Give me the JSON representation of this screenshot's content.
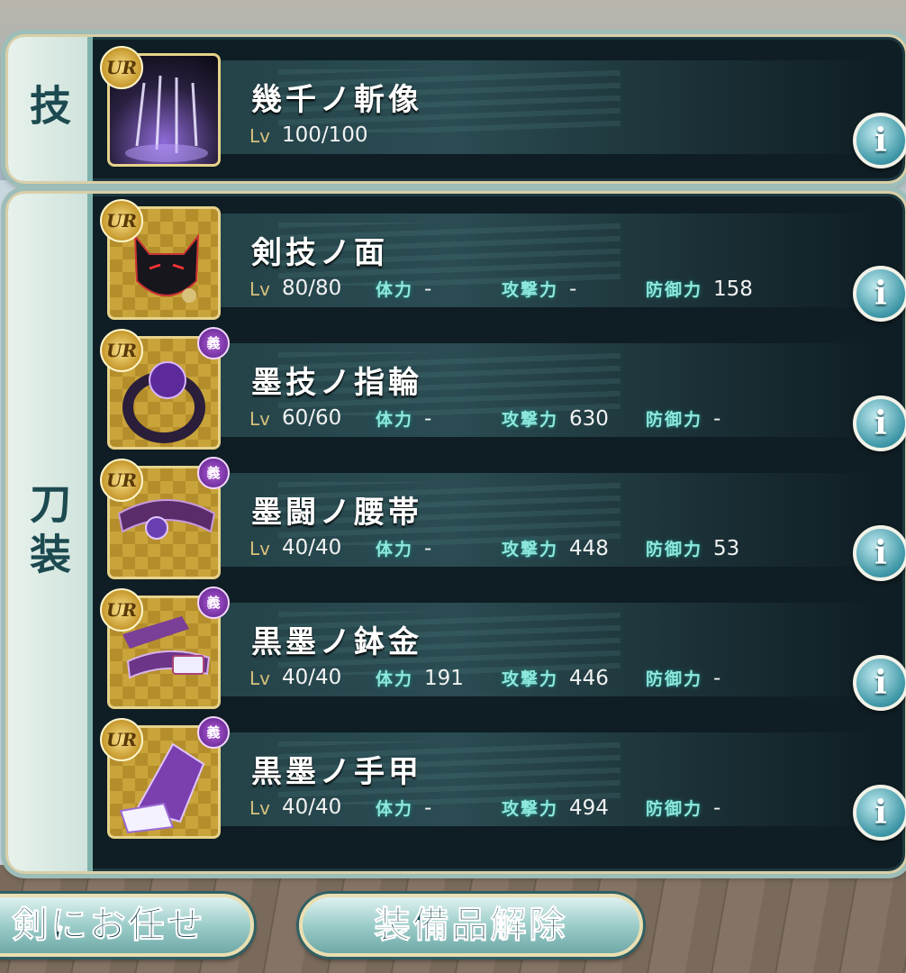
{
  "skill_section": {
    "label": "技",
    "item": {
      "rarity": "UR",
      "name": "幾千ノ斬像",
      "lv_key": "Lv",
      "lv": "100/100"
    }
  },
  "equip_section": {
    "label": "刀装",
    "stat_labels": {
      "hp": "体力",
      "atk": "攻撃力",
      "def": "防御力"
    },
    "items": [
      {
        "rarity": "UR",
        "mark": "",
        "name": "剣技ノ面",
        "lv": "80/80",
        "hp": "-",
        "atk": "-",
        "def": "158"
      },
      {
        "rarity": "UR",
        "mark": "義",
        "name": "墨技ノ指輪",
        "lv": "60/60",
        "hp": "-",
        "atk": "630",
        "def": "-"
      },
      {
        "rarity": "UR",
        "mark": "義",
        "name": "墨闘ノ腰帯",
        "lv": "40/40",
        "hp": "-",
        "atk": "448",
        "def": "53"
      },
      {
        "rarity": "UR",
        "mark": "義",
        "name": "黒墨ノ鉢金",
        "lv": "40/40",
        "hp": "191",
        "atk": "446",
        "def": "-"
      },
      {
        "rarity": "UR",
        "mark": "義",
        "name": "黒墨ノ手甲",
        "lv": "40/40",
        "hp": "-",
        "atk": "494",
        "def": "-"
      }
    ]
  },
  "info_icon": "i",
  "buttons": {
    "auto": "剣にお任せ",
    "release": "装備品解除"
  },
  "colors": {
    "panel": "#0f1e24",
    "frame": "#d9cfa7",
    "stat_label": "#8fe8dc",
    "lv_label": "#d6c07a"
  }
}
